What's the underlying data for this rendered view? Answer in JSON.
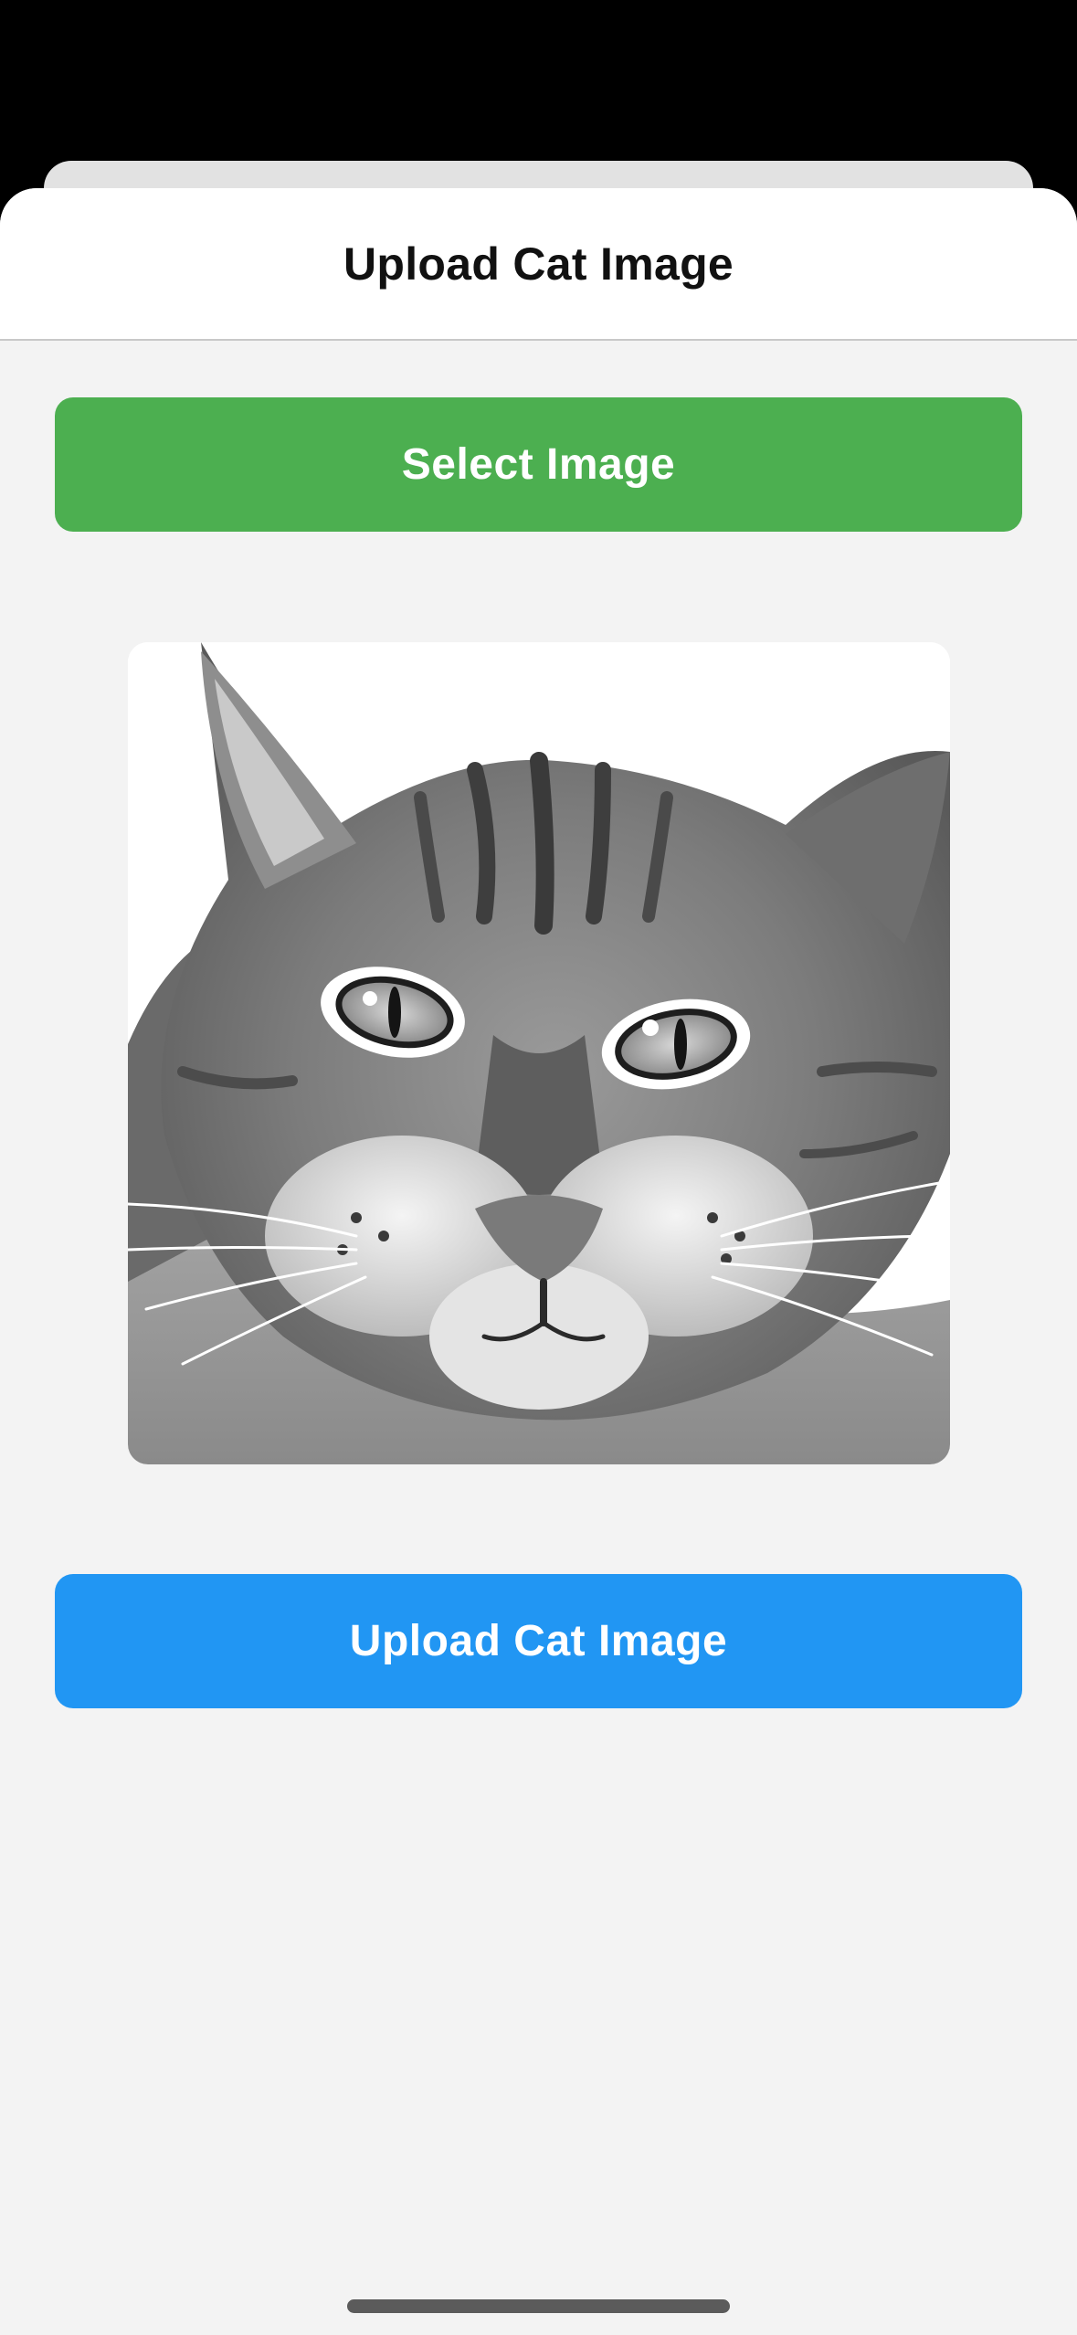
{
  "header": {
    "title": "Upload Cat Image"
  },
  "actions": {
    "select_label": "Select Image",
    "upload_label": "Upload Cat Image"
  },
  "preview": {
    "subject": "grayscale tabby cat face photo"
  },
  "colors": {
    "select_button": "#4caf50",
    "upload_button": "#2196f3",
    "sheet_background": "#f3f3f3",
    "header_background": "#ffffff"
  }
}
